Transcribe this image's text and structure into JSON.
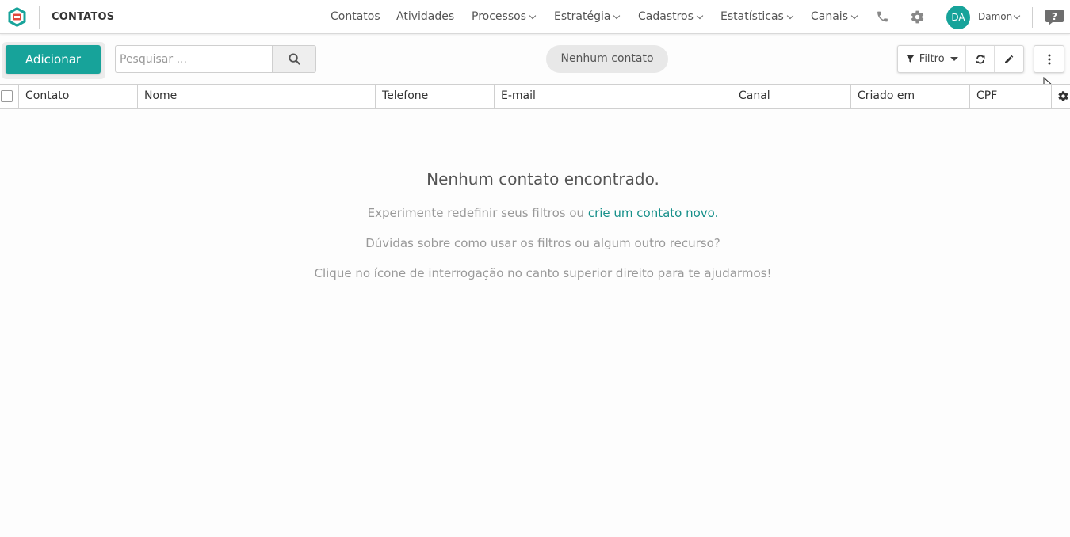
{
  "header": {
    "page_title": "CONTATOS",
    "nav": [
      {
        "label": "Contatos",
        "dropdown": false
      },
      {
        "label": "Atividades",
        "dropdown": false
      },
      {
        "label": "Processos",
        "dropdown": true
      },
      {
        "label": "Estratégia",
        "dropdown": true
      },
      {
        "label": "Cadastros",
        "dropdown": true
      },
      {
        "label": "Estatísticas",
        "dropdown": true
      },
      {
        "label": "Canais",
        "dropdown": true
      }
    ],
    "user": {
      "initials": "DA",
      "name": "Damon"
    }
  },
  "toolbar": {
    "add_label": "Adicionar",
    "search_placeholder": "Pesquisar ...",
    "search_value": "",
    "status": "Nenhum contato",
    "filter_label": "Filtro"
  },
  "table": {
    "columns": [
      "Contato",
      "Nome",
      "Telefone",
      "E-mail",
      "Canal",
      "Criado em",
      "CPF"
    ],
    "rows": []
  },
  "empty_state": {
    "title": "Nenhum contato encontrado.",
    "line1_prefix": "Experimente redefinir seus filtros ou ",
    "line1_link": "crie um contato novo.",
    "line2": "Dúvidas sobre como usar os filtros ou algum outro recurso?",
    "line3": "Clique no ícone de interrogação no canto superior direito para te ajudarmos!"
  },
  "colors": {
    "accent": "#17a39a",
    "link": "#17908a",
    "logo_red": "#e2473c"
  },
  "icons": [
    "app-logo-icon",
    "phone-icon",
    "gear-icon",
    "help-chat-icon",
    "search-icon",
    "filter-icon",
    "refresh-icon",
    "pencil-icon",
    "kebab-menu-icon",
    "mouse-cursor-icon",
    "column-settings-gear-icon"
  ]
}
